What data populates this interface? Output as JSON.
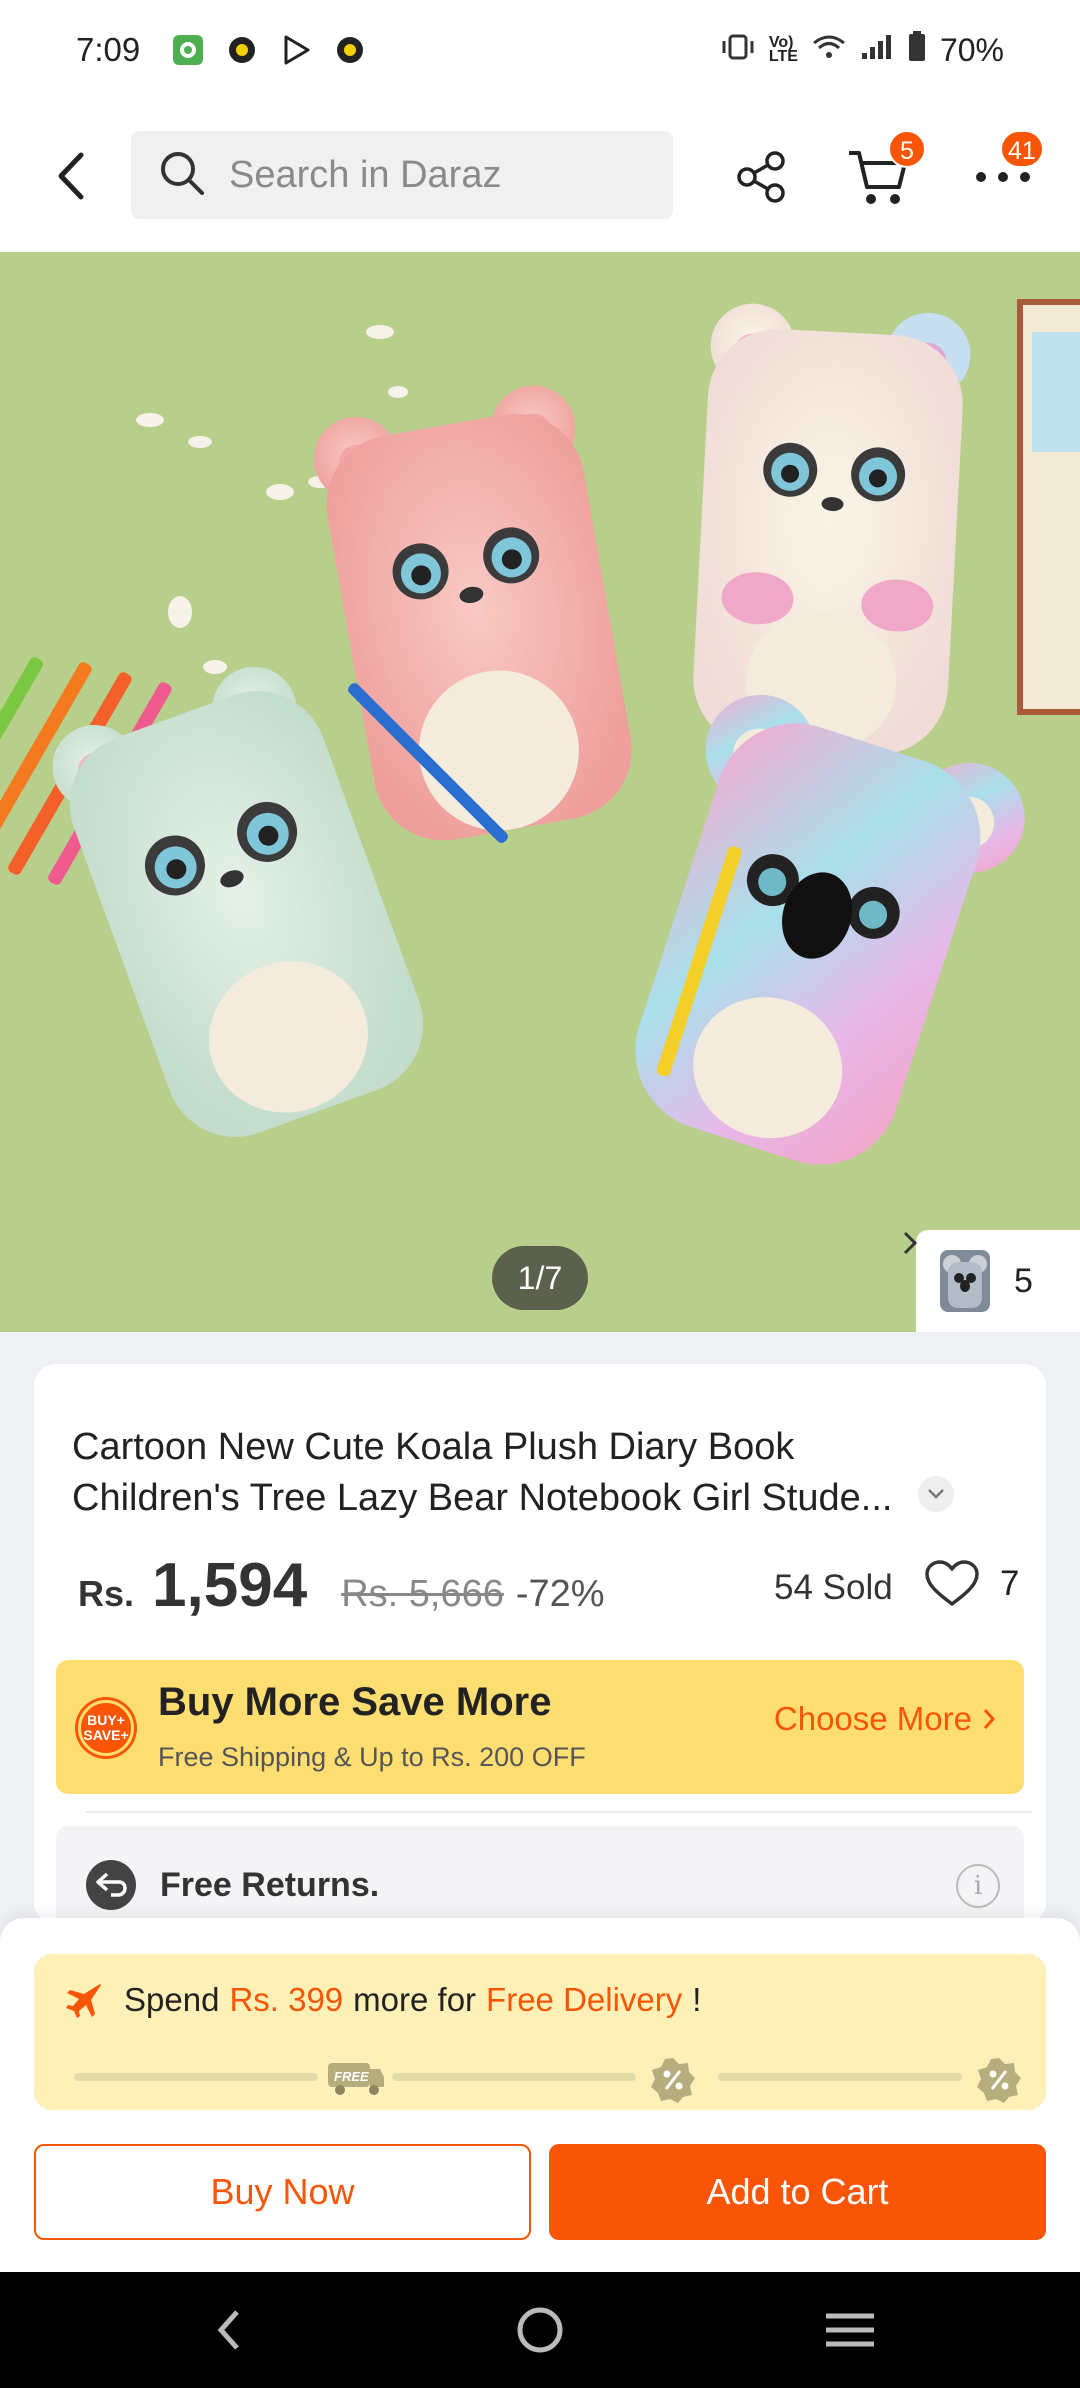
{
  "status_bar": {
    "time": "7:09",
    "battery": "70%",
    "network_label": "Vo) LTE"
  },
  "header": {
    "search_placeholder": "Search in Daraz",
    "cart_count": "5",
    "more_count": "41"
  },
  "gallery": {
    "counter": "1/7",
    "variant_count": "5"
  },
  "product": {
    "title": "Cartoon New Cute Koala Plush Diary Book Children's Tree Lazy Bear Notebook Girl Stude...",
    "currency": "Rs.",
    "price": "1,594",
    "original_price": "Rs. 5,666",
    "discount": "-72%",
    "sold": "54 Sold",
    "wishlist_count": "7"
  },
  "promo": {
    "badge": "BUY+ SAVE+",
    "title": "Buy More Save More",
    "subtitle": "Free Shipping & Up to Rs. 200 OFF",
    "link": "Choose More"
  },
  "returns": {
    "label": "Free Returns."
  },
  "delivery": {
    "prefix": "Spend",
    "amount": "Rs. 399",
    "middle": "more for",
    "highlight": "Free Delivery",
    "suffix": "!",
    "milestone_free_label": "FREE"
  },
  "actions": {
    "buy_now": "Buy Now",
    "add_to_cart": "Add to Cart"
  },
  "colors": {
    "accent": "#f85606",
    "promo_bg": "#ffde71",
    "delivery_bg": "#fff0b8"
  }
}
